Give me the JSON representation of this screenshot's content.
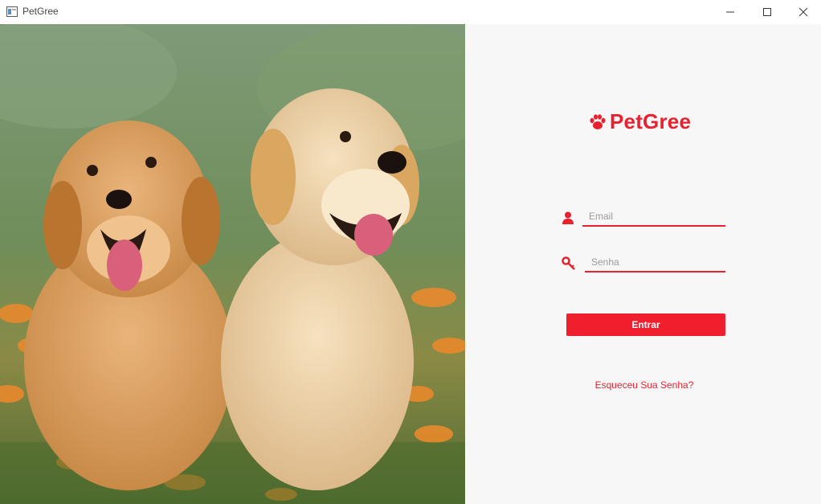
{
  "window": {
    "title": "PetGree",
    "minimize_icon": "minimize-icon",
    "maximize_icon": "maximize-icon",
    "close_icon": "close-icon"
  },
  "photo": {
    "description_icon": "photo"
  },
  "brand": {
    "name": "PetGree",
    "icon": "paw-icon",
    "color": "#e8212f"
  },
  "login": {
    "email_placeholder": "Email",
    "email_value": "",
    "email_icon": "user-icon",
    "password_placeholder": "Senha",
    "password_value": "",
    "password_icon": "key-icon",
    "submit_label": "Entrar",
    "submit_color": "#f01f2d",
    "forgot_label": "Esqueceu Sua Senha?"
  }
}
